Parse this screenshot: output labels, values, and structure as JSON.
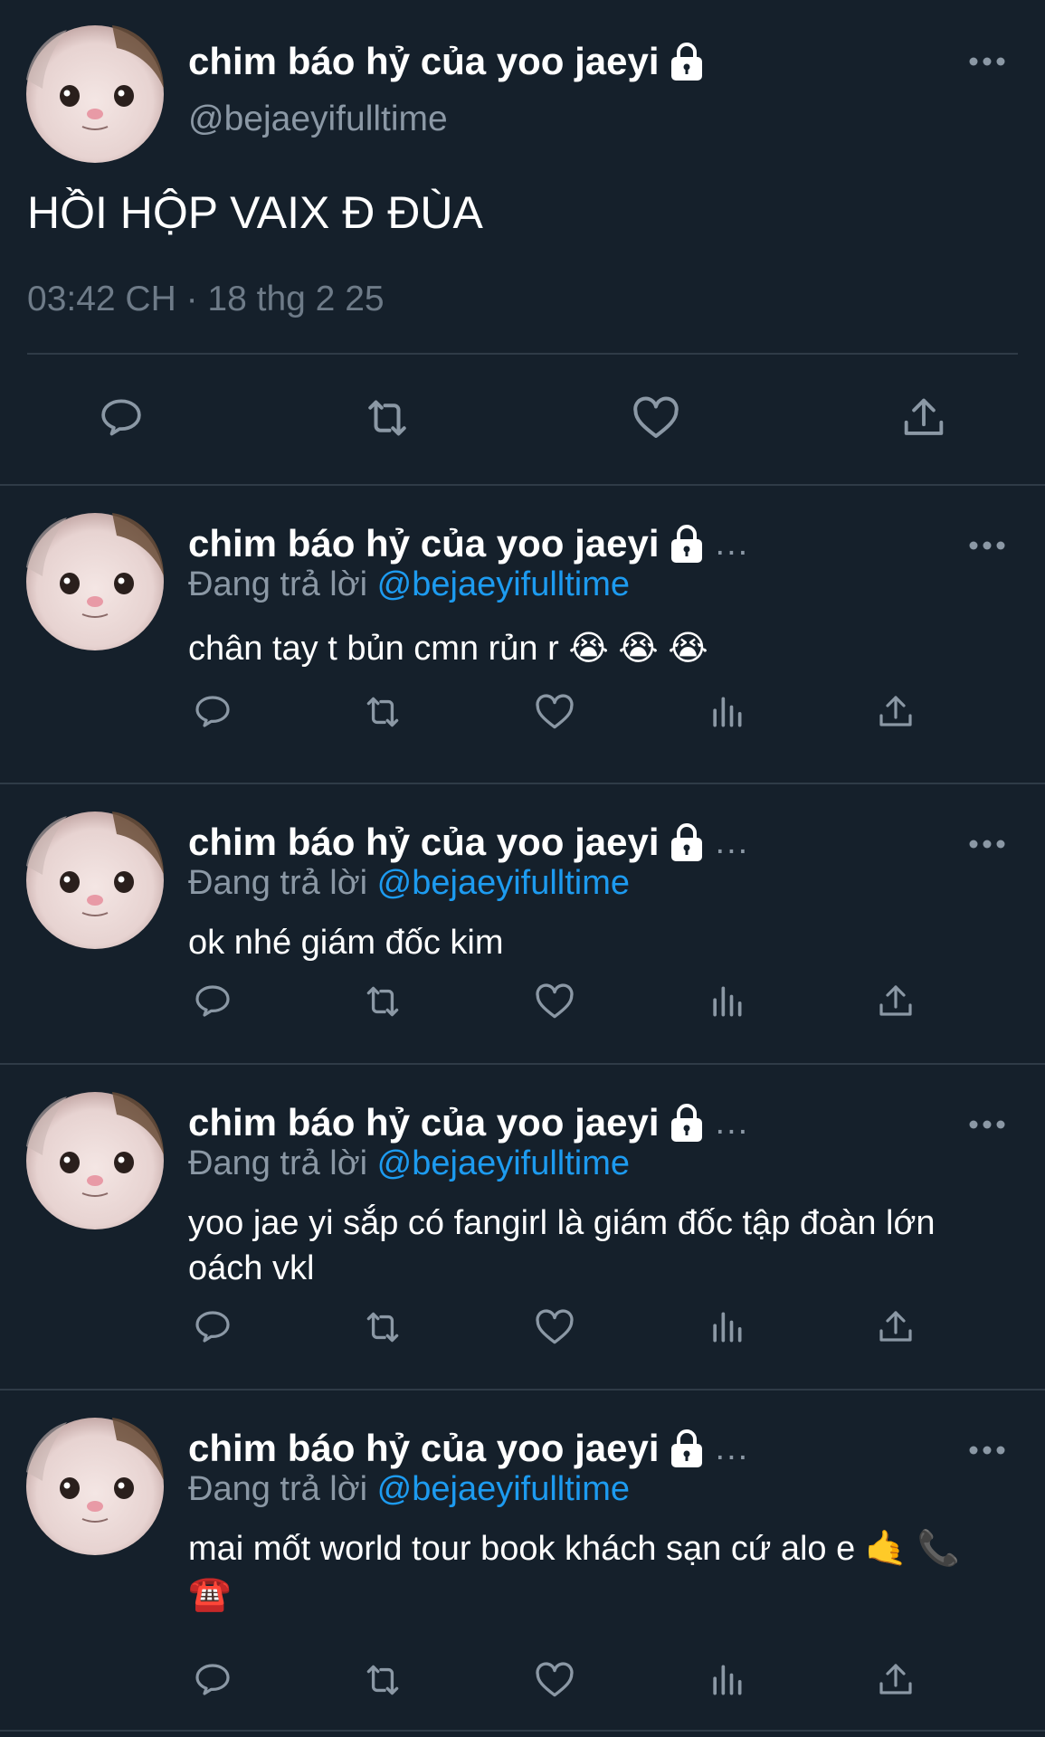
{
  "main_tweet": {
    "display_name": "chim báo hỷ của yoo jaeyi",
    "handle": "@bejaeyifulltime",
    "text": "HỒI HỘP VAIX Đ ĐÙA",
    "timestamp": "03:42 CH · 18 thg 2 25"
  },
  "replies": [
    {
      "display_name": "chim báo hỷ của yoo jaeyi",
      "truncation": "...",
      "replying_label": "Đang trả lời",
      "replying_to": "@bejaeyifulltime",
      "text": "chân tay t bủn cmn rủn r 😭 😭 😭"
    },
    {
      "display_name": "chim báo hỷ của yoo jaeyi",
      "truncation": "...",
      "replying_label": "Đang trả lời",
      "replying_to": "@bejaeyifulltime",
      "text": "ok nhé giám đốc kim"
    },
    {
      "display_name": "chim báo hỷ của yoo jaeyi",
      "truncation": "...",
      "replying_label": "Đang trả lời",
      "replying_to": "@bejaeyifulltime",
      "text": "yoo jae yi sắp có fangirl là giám đốc tập đoàn lớn oách vkl"
    },
    {
      "display_name": "chim báo hỷ của yoo jaeyi",
      "truncation": "...",
      "replying_label": "Đang trả lời",
      "replying_to": "@bejaeyifulltime",
      "text": "mai mốt world tour book khách sạn cứ alo e 🤙 📞 ☎️"
    }
  ],
  "icons": {
    "lock": "lock-icon",
    "more": "more-icon",
    "reply": "reply-icon",
    "retweet": "retweet-icon",
    "like": "heart-icon",
    "views": "views-icon",
    "share": "share-icon"
  },
  "colors": {
    "background": "#15202b",
    "divider": "#2f3b47",
    "secondary_text": "#8b98a5",
    "icon": "#8b98a5",
    "mention": "#1d9bf0",
    "primary_text": "#ffffff"
  }
}
